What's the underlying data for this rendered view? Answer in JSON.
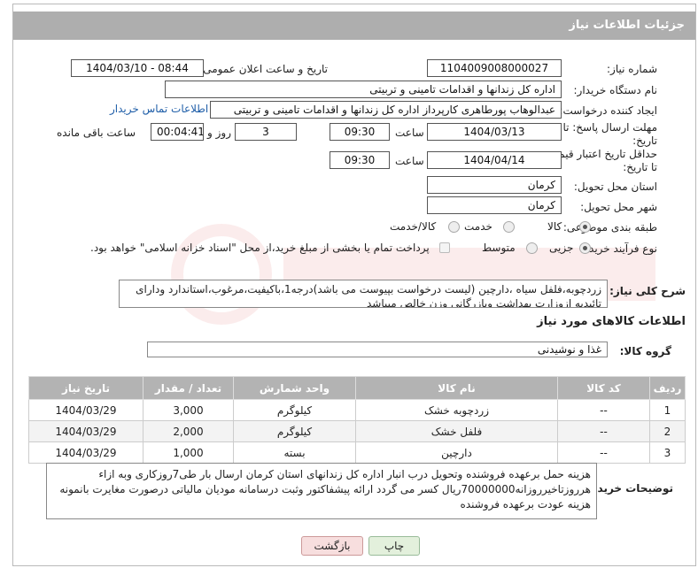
{
  "header": {
    "title": "جزئیات اطلاعات نیاز"
  },
  "form": {
    "need_number_label": "شماره نیاز:",
    "need_number": "1104009008000027",
    "announce_label": "تاریخ و ساعت اعلان عمومی:",
    "announce_value": "1404/03/10 - 08:44",
    "buyer_org_label": "نام دستگاه خریدار:",
    "buyer_org": "اداره کل زندانها و اقدامات تامینی و تربیتی",
    "creator_label": "ایجاد کننده درخواست:",
    "creator": "عبدالوهاب پورطاهری کارپرداز اداره کل زندانها و اقدامات تامینی و تربیتی",
    "contact_link": "اطلاعات تماس خریدار",
    "reply_deadline_label_1": "مهلت ارسال پاسخ: تا",
    "reply_deadline_label_2": "تاریخ:",
    "reply_date": "1404/03/13",
    "time_label": "ساعت",
    "reply_time": "09:30",
    "days": "3",
    "days_label": "روز و",
    "remaining": "00:04:41",
    "remaining_label": "ساعت باقی مانده",
    "price_valid_label_1": "حداقل تاریخ اعتبار قیمت:",
    "price_valid_label_2": "تا تاریخ:",
    "price_valid_date": "1404/04/14",
    "price_valid_time": "09:30",
    "province_label": "استان محل تحویل:",
    "province": "کرمان",
    "city_label": "شهر محل تحویل:",
    "city": "کرمان",
    "category_label": "طبقه بندی موضوعی:",
    "category_options": [
      "کالا",
      "خدمت",
      "کالا/خدمت"
    ],
    "category_selected": "کالا",
    "process_label": "نوع فرآیند خرید :",
    "process_options": [
      "جزیی",
      "متوسط"
    ],
    "process_selected": "جزیی",
    "payment_note": "پرداخت تمام یا بخشی از مبلغ خرید،از محل \"اسناد خزانه اسلامی\" خواهد بود.",
    "description_label": "شرح کلی نیاز:",
    "description": "زردچوبه،فلفل سیاه ،دارچین (لیست درخواست بپیوست می باشد)درجه1،باکیفیت،مرغوب،استاندارد ودارای تائیدیه ازوزارت بهداشت وبازرگانی وزن خالص میباشد"
  },
  "goods": {
    "section_title": "اطلاعات کالاهای مورد نیاز",
    "group_label": "گروه کالا:",
    "group_value": "غذا و نوشیدنی",
    "columns": [
      "ردیف",
      "کد کالا",
      "نام کالا",
      "واحد شمارش",
      "تعداد / مقدار",
      "تاریخ نیاز"
    ],
    "rows": [
      [
        "1",
        "--",
        "زردچوبه خشک",
        "کیلوگرم",
        "3,000",
        "1404/03/29"
      ],
      [
        "2",
        "--",
        "فلفل خشک",
        "کیلوگرم",
        "2,000",
        "1404/03/29"
      ],
      [
        "3",
        "--",
        "دارچین",
        "بسته",
        "1,000",
        "1404/03/29"
      ]
    ]
  },
  "buyer_notes": {
    "label": "توضیحات خریدار:",
    "text": "هزینه حمل برعهده فروشنده وتحویل درب انبار اداره کل زندانهای استان کرمان ارسال بار طی7روزکاری وبه ازاء هرروزتاخیرروزانه70000000ریال کسر می گردد ارائه پیشفاکتور وثبت درسامانه مودیان مالیاتی درصورت مغایرت بانمونه هزینه عودت برعهده فروشنده"
  },
  "buttons": {
    "print": "چاپ",
    "back": "بازگشت"
  },
  "colors": {
    "header_bg": "#aeaeae",
    "link": "#1f5ea8",
    "back_btn": "#f7dede",
    "print_btn": "#e3f0dc"
  }
}
